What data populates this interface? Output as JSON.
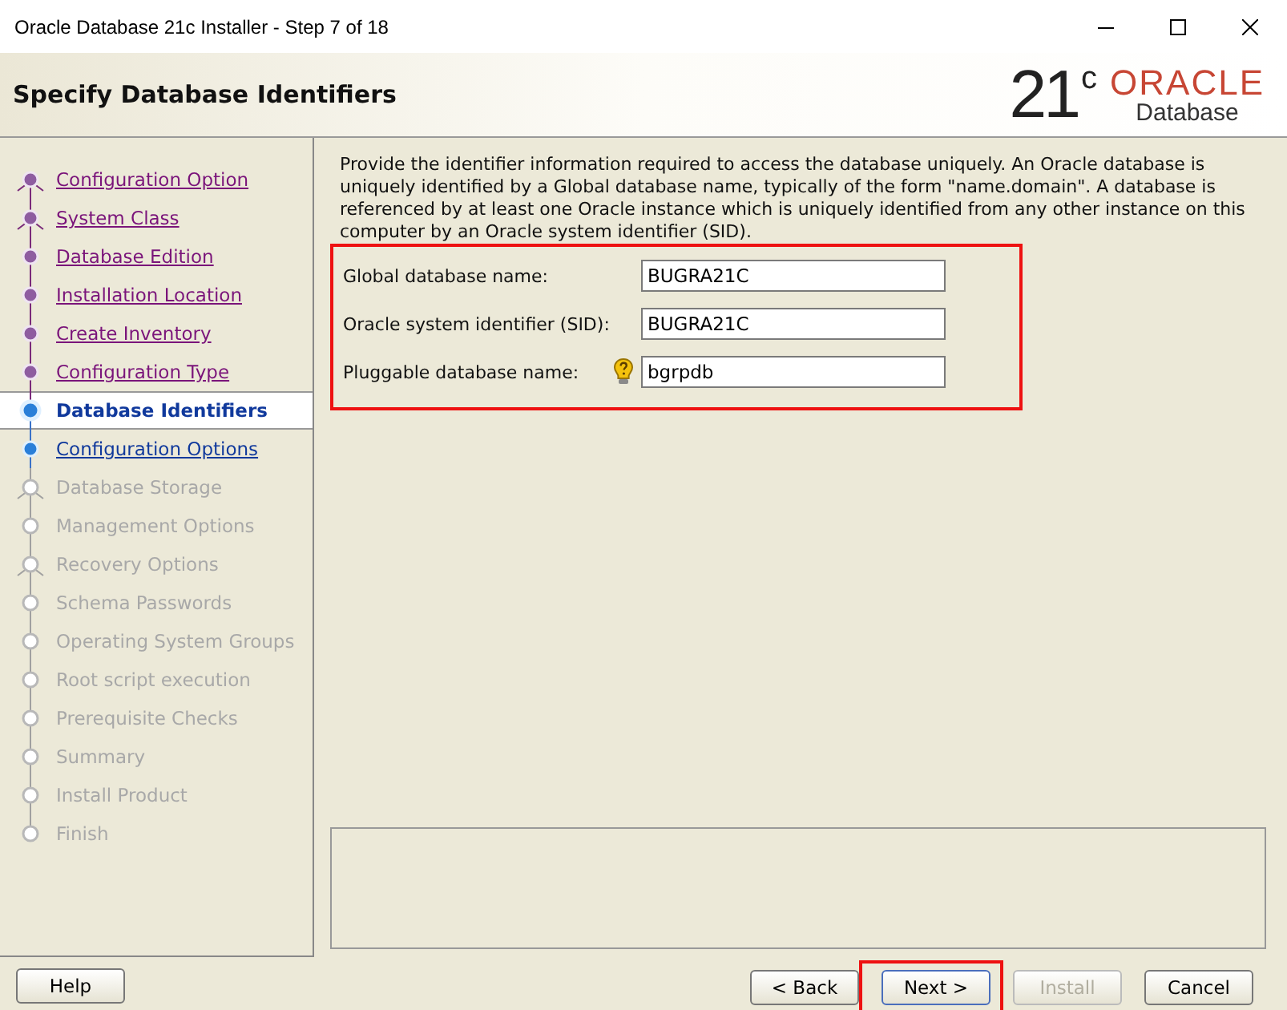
{
  "window": {
    "title": "Oracle Database 21c Installer - Step 7 of 18"
  },
  "header": {
    "title": "Specify Database Identifiers",
    "logo_version": "21",
    "logo_superscript": "c",
    "logo_brand": "ORACLE",
    "logo_product": "Database"
  },
  "steps": [
    {
      "label": "Configuration Option",
      "selected": false,
      "visited": true,
      "enabled": true,
      "branch": true
    },
    {
      "label": "System Class",
      "selected": false,
      "visited": true,
      "enabled": true,
      "branch": true
    },
    {
      "label": "Database Edition",
      "selected": false,
      "visited": true,
      "enabled": true,
      "branch": false
    },
    {
      "label": "Installation Location",
      "selected": false,
      "visited": true,
      "enabled": true,
      "branch": false
    },
    {
      "label": "Create Inventory",
      "selected": false,
      "visited": true,
      "enabled": true,
      "branch": false
    },
    {
      "label": "Configuration Type",
      "selected": false,
      "visited": true,
      "enabled": true,
      "branch": false
    },
    {
      "label": "Database Identifiers",
      "selected": true,
      "visited": false,
      "enabled": true,
      "branch": false
    },
    {
      "label": "Configuration Options",
      "selected": false,
      "visited": false,
      "enabled": true,
      "branch": false
    },
    {
      "label": "Database Storage",
      "selected": false,
      "visited": false,
      "enabled": false,
      "branch": true
    },
    {
      "label": "Management Options",
      "selected": false,
      "visited": false,
      "enabled": false,
      "branch": false
    },
    {
      "label": "Recovery Options",
      "selected": false,
      "visited": false,
      "enabled": false,
      "branch": true
    },
    {
      "label": "Schema Passwords",
      "selected": false,
      "visited": false,
      "enabled": false,
      "branch": false
    },
    {
      "label": "Operating System Groups",
      "selected": false,
      "visited": false,
      "enabled": false,
      "branch": false
    },
    {
      "label": "Root script execution",
      "selected": false,
      "visited": false,
      "enabled": false,
      "branch": false
    },
    {
      "label": "Prerequisite Checks",
      "selected": false,
      "visited": false,
      "enabled": false,
      "branch": false
    },
    {
      "label": "Summary",
      "selected": false,
      "visited": false,
      "enabled": false,
      "branch": false
    },
    {
      "label": "Install Product",
      "selected": false,
      "visited": false,
      "enabled": false,
      "branch": false
    },
    {
      "label": "Finish",
      "selected": false,
      "visited": false,
      "enabled": false,
      "branch": false
    }
  ],
  "description": "Provide the identifier information required to access the database uniquely. An Oracle database is uniquely identified by a Global database name, typically of the form \"name.domain\". A database is referenced by at least one Oracle instance which is uniquely identified from any other instance on this computer by an Oracle system identifier (SID).",
  "form": {
    "highlighted": true,
    "fields": [
      {
        "label": "Global database name:",
        "value": "BUGRA21C",
        "hint": false
      },
      {
        "label": "Oracle system identifier (SID):",
        "value": "BUGRA21C",
        "hint": false
      },
      {
        "label": "Pluggable database name:",
        "value": "bgrpdb",
        "hint": true
      }
    ]
  },
  "buttons": [
    {
      "label": "Help",
      "kind": "help",
      "disabled": false,
      "highlighted": false
    },
    {
      "label": "< Back",
      "kind": "nav",
      "disabled": false,
      "highlighted": false
    },
    {
      "label": "Next >",
      "kind": "nav",
      "disabled": false,
      "highlighted": true
    },
    {
      "label": "Install",
      "kind": "nav",
      "disabled": true,
      "highlighted": false
    },
    {
      "label": "Cancel",
      "kind": "cancel",
      "disabled": false,
      "highlighted": false
    }
  ]
}
